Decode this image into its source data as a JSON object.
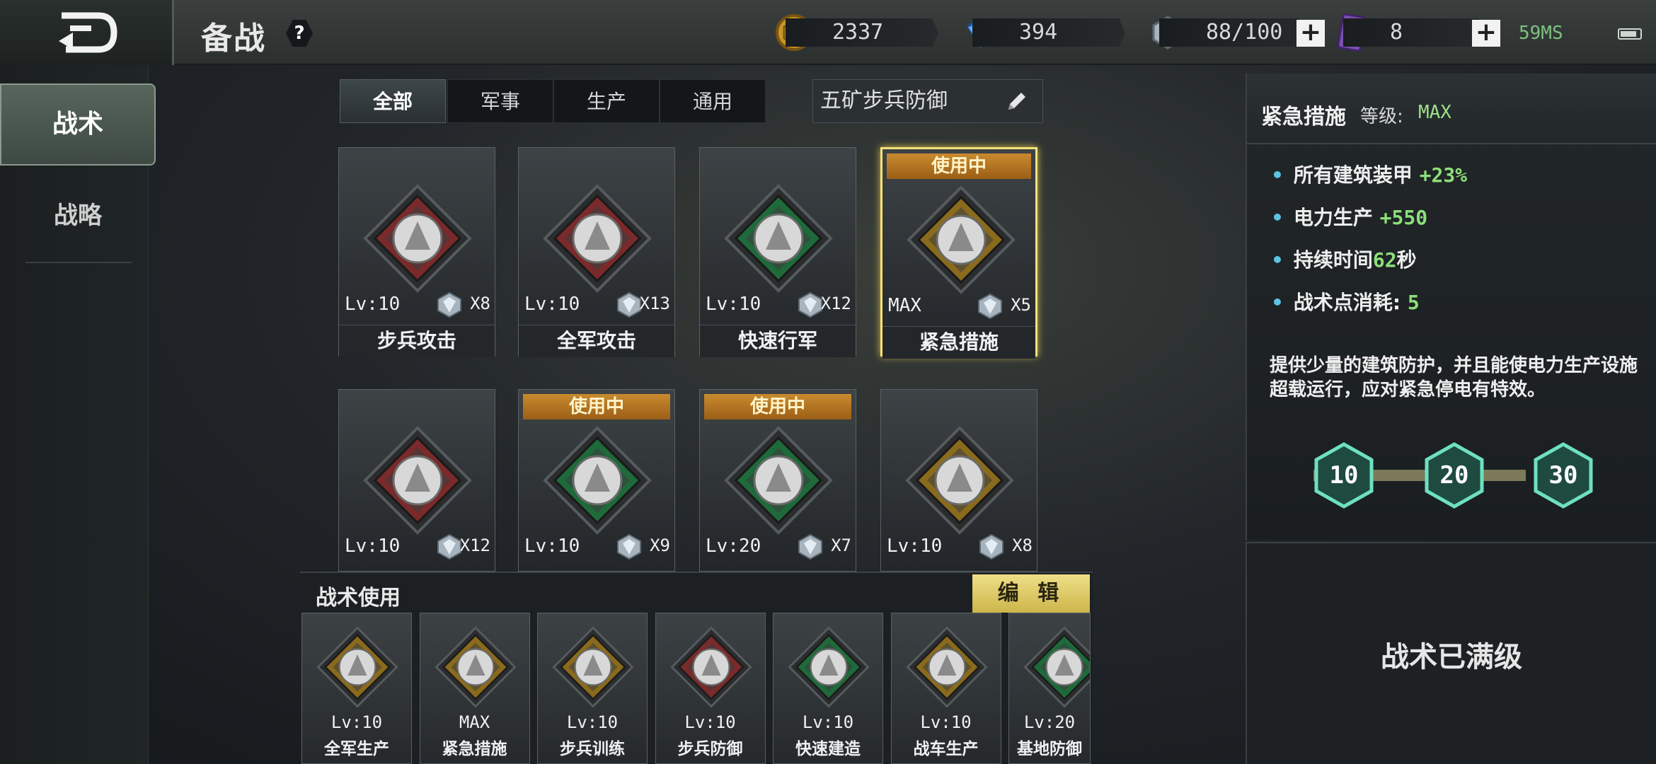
{
  "header": {
    "title": "备战",
    "help": "?",
    "gold": "2337",
    "diamond": "394",
    "tactic_points": "88/100",
    "cards": "8",
    "plus": "+",
    "ping": "59MS"
  },
  "sidebar": {
    "tabs": [
      {
        "label": "战术",
        "active": true
      },
      {
        "label": "战略",
        "active": false
      }
    ]
  },
  "filters": {
    "tabs": [
      {
        "label": "全部",
        "active": true
      },
      {
        "label": "军事",
        "active": false
      },
      {
        "label": "生产",
        "active": false
      },
      {
        "label": "通用",
        "active": false
      }
    ],
    "preset_name": "五矿步兵防御"
  },
  "cards": [
    {
      "name": "步兵攻击",
      "level": "Lv:10",
      "count": "X8",
      "in_use": false,
      "in_use_label": "",
      "theme": "red",
      "icon": "infantry-attack-icon",
      "selected": false
    },
    {
      "name": "全军攻击",
      "level": "Lv:10",
      "count": "X13",
      "in_use": false,
      "in_use_label": "",
      "theme": "red",
      "icon": "army-attack-icon",
      "selected": false
    },
    {
      "name": "快速行军",
      "level": "Lv:10",
      "count": "X12",
      "in_use": false,
      "in_use_label": "",
      "theme": "green",
      "icon": "rapid-march-icon",
      "selected": false
    },
    {
      "name": "紧急措施",
      "level": "MAX",
      "count": "X5",
      "in_use": true,
      "in_use_label": "使用中",
      "theme": "gold",
      "icon": "emergency-dome-icon",
      "selected": true
    },
    {
      "name": "",
      "level": "Lv:10",
      "count": "X12",
      "in_use": false,
      "in_use_label": "",
      "theme": "red",
      "icon": "tank-icon",
      "selected": false
    },
    {
      "name": "",
      "level": "Lv:10",
      "count": "X9",
      "in_use": true,
      "in_use_label": "使用中",
      "theme": "green",
      "icon": "construction-crane-icon",
      "selected": false
    },
    {
      "name": "",
      "level": "Lv:20",
      "count": "X7",
      "in_use": true,
      "in_use_label": "使用中",
      "theme": "green",
      "icon": "armor-shield-icon",
      "selected": false
    },
    {
      "name": "",
      "level": "Lv:10",
      "count": "X8",
      "in_use": false,
      "in_use_label": "",
      "theme": "gold",
      "icon": "jet-gear-icon",
      "selected": false
    }
  ],
  "usage": {
    "title": "战术使用",
    "edit_label": "编 辑",
    "slots": [
      {
        "name": "全军生产",
        "level": "Lv:10",
        "theme": "gold",
        "icon": "factory-icon"
      },
      {
        "name": "紧急措施",
        "level": "MAX",
        "theme": "gold",
        "icon": "emergency-dome-icon"
      },
      {
        "name": "步兵训练",
        "level": "Lv:10",
        "theme": "gold",
        "icon": "infantry-training-icon"
      },
      {
        "name": "步兵防御",
        "level": "Lv:10",
        "theme": "red",
        "icon": "infantry-defense-icon"
      },
      {
        "name": "快速建造",
        "level": "Lv:10",
        "theme": "green",
        "icon": "construction-crane-icon"
      },
      {
        "name": "战车生产",
        "level": "Lv:10",
        "theme": "gold",
        "icon": "tank-production-icon"
      },
      {
        "name": "基地防御",
        "level": "Lv:20",
        "theme": "green",
        "icon": "armor-shield-icon"
      }
    ]
  },
  "detail": {
    "name": "紧急措施",
    "level_label": "等级:",
    "level": "MAX",
    "stats": [
      {
        "label": "所有建筑装甲",
        "value": "+23%"
      },
      {
        "label": "电力生产",
        "value": "+550"
      },
      {
        "label": "持续时间",
        "value": "62",
        "suffix": "秒"
      },
      {
        "label": "战术点消耗:",
        "value": "5"
      }
    ],
    "description": "提供少量的建筑防护，并且能使电力生产设施超载运行，应对紧急停电有特效。",
    "levels": [
      "10",
      "20",
      "30"
    ],
    "maxed_text": "战术已满级"
  },
  "colors": {
    "red": "#7a2a2a",
    "green": "#1f6a3a",
    "gold": "#8a6a1c",
    "accent_green": "#8ce07a",
    "highlight": "#f5e27a"
  }
}
